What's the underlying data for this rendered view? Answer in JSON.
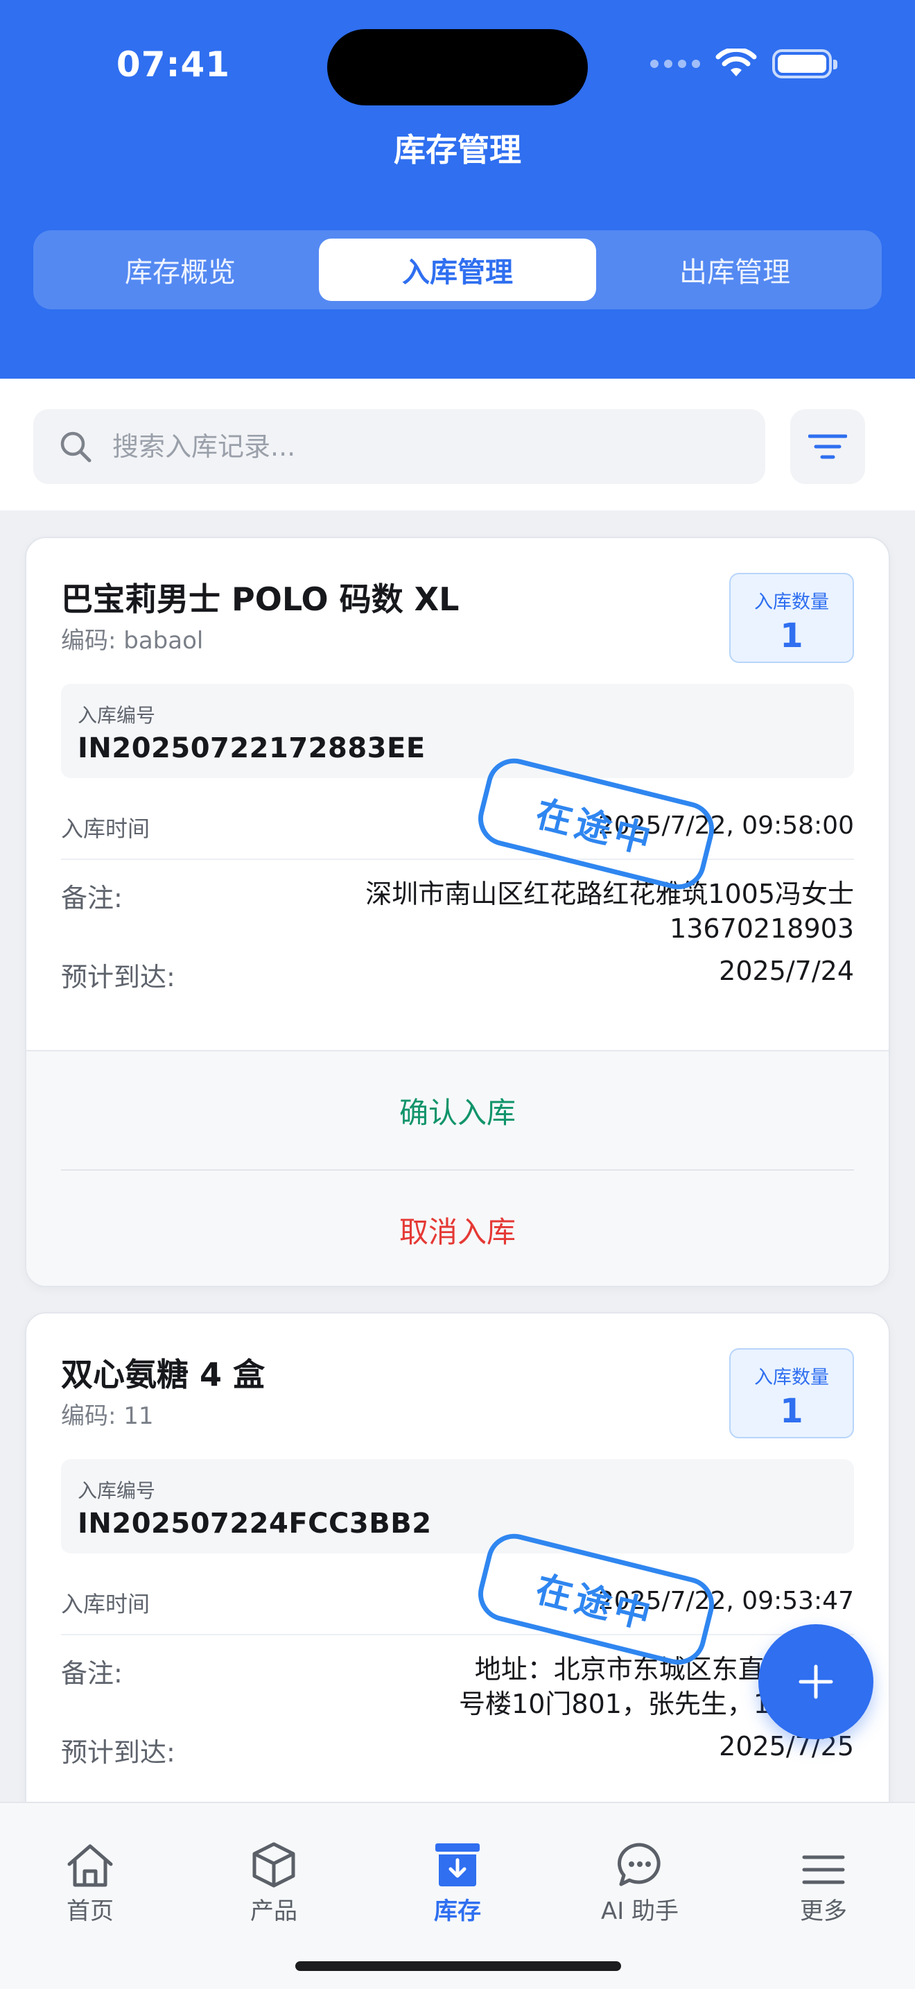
{
  "status_bar": {
    "time": "07:41"
  },
  "header": {
    "title": "库存管理",
    "tabs": [
      {
        "label": "库存概览",
        "active": false
      },
      {
        "label": "入库管理",
        "active": true
      },
      {
        "label": "出库管理",
        "active": false
      }
    ]
  },
  "search": {
    "placeholder": "搜索入库记录..."
  },
  "records": [
    {
      "name": "巴宝莉男士 POLO 码数 XL",
      "code": "编码: babaol",
      "qty_label": "入库数量",
      "qty": "1",
      "no_label": "入库编号",
      "no": "IN20250722172883EE",
      "time_label": "入库时间",
      "time": "2025/7/22, 09:58:00",
      "status": "在途中",
      "note_label": "备注:",
      "note": "深圳市南山区红花路红花雅筑1005冯女士13670218903",
      "eta_label": "预计到达:",
      "eta": "2025/7/24",
      "confirm": "确认入库",
      "cancel": "取消入库"
    },
    {
      "name": "双心氨糖 4 盒",
      "code": "编码: 11",
      "qty_label": "入库数量",
      "qty": "1",
      "no_label": "入库编号",
      "no": "IN202507224FCC3BB2",
      "time_label": "入库时间",
      "time": "2025/7/22, 09:53:47",
      "status": "在途中",
      "note_label": "备注:",
      "note": "地址：北京市东城区东直门内北!\n号楼10门801，张先生，139101",
      "eta_label": "预计到达:",
      "eta": "2025/7/25"
    }
  ],
  "tabbar": {
    "items": [
      {
        "label": "首页",
        "icon": "home-icon",
        "active": false
      },
      {
        "label": "产品",
        "icon": "box-icon",
        "active": false
      },
      {
        "label": "库存",
        "icon": "inventory-icon",
        "active": true
      },
      {
        "label": "AI 助手",
        "icon": "chat-icon",
        "active": false
      },
      {
        "label": "更多",
        "icon": "menu-icon",
        "active": false
      }
    ]
  },
  "colors": {
    "primary": "#2f6ff0",
    "confirm": "#11946a",
    "cancel": "#e53935",
    "stamp": "#2f86f0"
  }
}
